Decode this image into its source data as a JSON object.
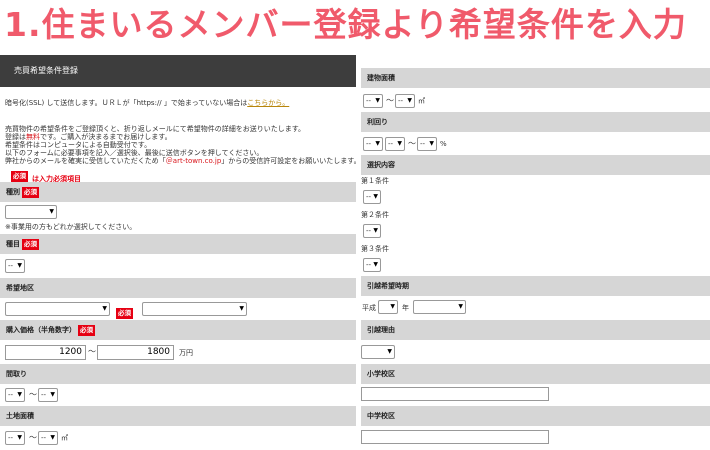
{
  "headline": "1.住まいるメンバー登録より希望条件を入力",
  "form_title": "売買希望条件登録",
  "intro": {
    "line1_a": "暗号化(SSL) して送信します。ＵＲＬが「https:// 」で始まっていない場合は",
    "line1_link": "こちらから。",
    "line2": "売買物件の希望条件をご登録頂くと、折り返しメールにて希望物件の詳細をお送りいたします。",
    "line3_a": "登録は",
    "line3_red": "無料",
    "line3_b": "です。ご購入が決まるまでお届けします。",
    "line4": "希望条件はコンピュータによる自動受付です。",
    "line5": "以下のフォームに必要事項を記入／選択後、最後に送信ボタンを押してください。",
    "line6_a": "弊社からのメールを確実に受信していただくため「",
    "line6_red": "＠art-town.co.jp",
    "line6_b": "」からの受信許可設定をお願いいたします。"
  },
  "required_badge": "必須",
  "required_note": "は入力必須項目",
  "left": {
    "shubetsu_label": "種別",
    "shubetsu_select": "",
    "shubetsu_note": "※事業用の方もどれか選択してください。",
    "shumoku_label": "種目",
    "shumoku_select": "--",
    "area_label": "希望地区",
    "area_select1": "",
    "area_select2": "",
    "price_label": "購入価格（半角数字）",
    "price_min": "1200",
    "price_tilde": "〜",
    "price_max": "1800",
    "price_unit": "万円",
    "madori_label": "間取り",
    "madori_min": "--",
    "madori_tilde": "〜",
    "madori_max": "--",
    "land_label": "土地面積",
    "land_min": "--",
    "land_tilde": "〜",
    "land_max": "--",
    "land_unit": "㎡"
  },
  "right": {
    "building_label": "建物面積",
    "building_min": "--",
    "building_tilde": "〜",
    "building_max": "--",
    "building_unit": "㎡",
    "yield_label": "利回り",
    "yield_min1": "--",
    "yield_min2": "--",
    "yield_tilde": "〜",
    "yield_max": "--",
    "yield_unit": "%",
    "select_label": "選択内容",
    "cond1_label": "第１条件",
    "cond1_select": "--",
    "cond2_label": "第２条件",
    "cond2_select": "--",
    "cond3_label": "第３条件",
    "cond3_select": "--",
    "move_time_label": "引越希望時期",
    "era": "平成",
    "year_select": "",
    "year_unit": "年",
    "month_select": "",
    "move_reason_label": "引越理由",
    "move_reason_select": "",
    "elementary_label": "小学校区",
    "elementary_value": "",
    "junior_label": "中学校区",
    "junior_value": ""
  }
}
